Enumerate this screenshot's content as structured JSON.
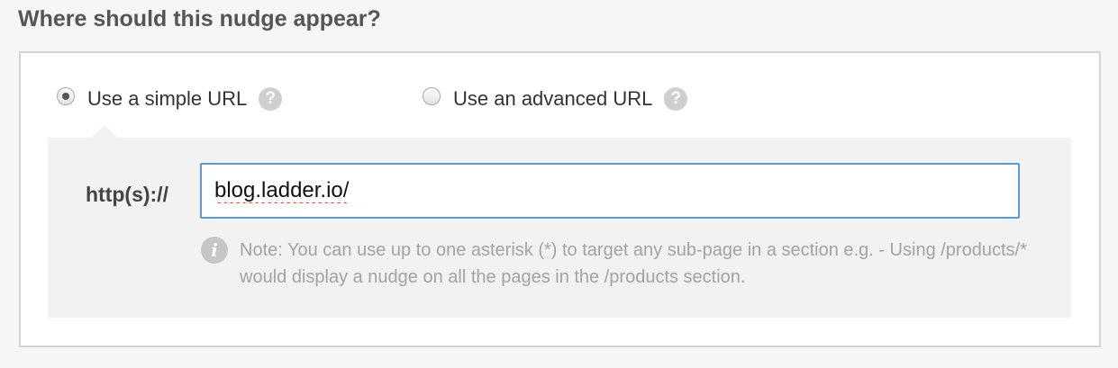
{
  "heading": "Where should this nudge appear?",
  "url_options": {
    "simple": {
      "label": "Use a simple URL",
      "selected": true,
      "help_icon": "question-icon"
    },
    "advanced": {
      "label": "Use an advanced URL",
      "selected": false,
      "help_icon": "question-icon"
    }
  },
  "url_field": {
    "prefix": "http(s)://",
    "value": "blog.ladder.io/"
  },
  "note": {
    "icon": "info-icon",
    "glyph": "i",
    "text": "Note: You can use up to one asterisk (*) to target any sub-page in a section e.g. - Using /products/* would display a nudge on all the pages in the /products section."
  },
  "help_glyph": "?",
  "colors": {
    "accent_border": "#5b9ad9",
    "note_text": "#a3a3a3",
    "heading_text": "#555555"
  }
}
